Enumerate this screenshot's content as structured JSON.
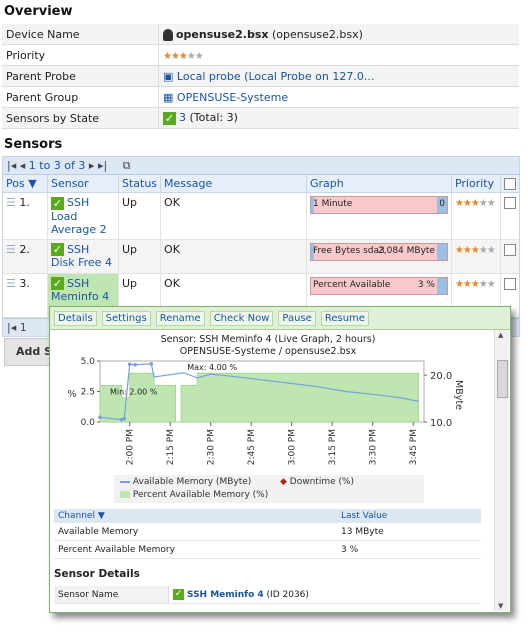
{
  "overview": {
    "title": "Overview",
    "rows": [
      {
        "label": "Device Name",
        "value": "opensuse2.bsx",
        "extra": "(opensuse2.bsx)"
      },
      {
        "label": "Priority",
        "stars_on": 3,
        "stars_off": 2
      },
      {
        "label": "Parent Probe",
        "value": "Local probe (Local Probe on 127.0..."
      },
      {
        "label": "Parent Group",
        "value": "OPENSUSE-Systeme"
      },
      {
        "label": "Sensors by State",
        "value": "3",
        "extra": "(Total: 3)"
      }
    ]
  },
  "sensors": {
    "title": "Sensors",
    "pager": "1 to 3 of 3",
    "columns": [
      "Pos",
      "Sensor",
      "Status",
      "Message",
      "Graph",
      "Priority"
    ],
    "rows": [
      {
        "pos": "1.",
        "name": "SSH Load Average 2",
        "status": "Up",
        "message": "OK",
        "graph": "1 Minute",
        "graph_value": "0"
      },
      {
        "pos": "2.",
        "name": "SSH Disk Free 4",
        "status": "Up",
        "message": "OK",
        "graph": "Free Bytes sda3",
        "graph_value": "2,084 MByte"
      },
      {
        "pos": "3.",
        "name": "SSH Meminfo 4",
        "status": "Up",
        "message": "OK",
        "graph": "Percent Available",
        "graph_value": "3 %"
      }
    ],
    "bottom_pager": "1",
    "add_label": "Add Se"
  },
  "popup": {
    "tabs": [
      "Details",
      "Settings",
      "Rename",
      "Check Now",
      "Pause",
      "Resume"
    ],
    "chart_title_1": "Sensor: SSH Meminfo 4 (Live Graph, 2 hours)",
    "chart_title_2": "OPENSUSE-Systeme / opensuse2.bsx",
    "legend": [
      "Available Memory (MByte)",
      "Downtime (%)",
      "Percent Available Memory (%)"
    ],
    "channel_header": "Channel",
    "last_value_header": "Last Value",
    "channels": [
      {
        "name": "Available Memory",
        "value": "13 MByte"
      },
      {
        "name": "Percent Available Memory",
        "value": "3 %"
      }
    ],
    "details_title": "Sensor Details",
    "sensor_name_label": "Sensor Name",
    "sensor_name_value": "SSH Meminfo 4",
    "sensor_id": "(ID 2036)",
    "colors": {
      "memory_line": "#7a9fe0",
      "percent_fill": "#9fd58c",
      "downtime": "#b02020"
    }
  },
  "chart_data": {
    "type": "line",
    "title": "Sensor: SSH Meminfo 4 (Live Graph, 2 hours)",
    "subtitle": "OPENSUSE-Systeme / opensuse2.bsx",
    "x_ticks": [
      "2:00 PM",
      "2:15 PM",
      "2:30 PM",
      "2:45 PM",
      "3:00 PM",
      "3:15 PM",
      "3:30 PM",
      "3:45 PM"
    ],
    "y_left": {
      "label": "%",
      "ticks": [
        "0.0",
        "2.5",
        "5.0"
      ],
      "range": [
        0,
        5
      ]
    },
    "y_right": {
      "label": "MByte",
      "ticks": [
        "10.0",
        "20.0"
      ],
      "range": [
        10,
        23
      ]
    },
    "annotations": [
      "Max: 4.00 %",
      "Min: 2.00 %"
    ],
    "series": [
      {
        "name": "Available Memory (MByte)",
        "axis": "right",
        "x": [
          "1:49 PM",
          "1:57 PM",
          "1:58 PM",
          "2:00 PM",
          "2:02 PM",
          "2:08 PM",
          "2:09 PM",
          "2:20 PM",
          "2:25 PM",
          "2:30 PM",
          "2:40 PM",
          "2:50 PM",
          "3:00 PM",
          "3:10 PM",
          "3:20 PM",
          "3:30 PM",
          "3:40 PM",
          "3:47 PM"
        ],
        "values": [
          11.0,
          10.5,
          10.7,
          22.3,
          22.2,
          22.4,
          19.6,
          20.5,
          19.4,
          20.2,
          19.6,
          18.9,
          18.2,
          17.5,
          16.5,
          15.9,
          15.2,
          14.4
        ]
      },
      {
        "name": "Percent Available Memory (%)",
        "axis": "left",
        "x": [
          "1:49 PM",
          "1:57 PM",
          "1:58 PM",
          "2:00 PM",
          "2:09 PM",
          "2:17 PM",
          "2:19 PM",
          "2:24 PM",
          "2:25 PM",
          "3:47 PM"
        ],
        "values": [
          3,
          2,
          2,
          4,
          3,
          0,
          3,
          3,
          4,
          3
        ]
      }
    ]
  }
}
